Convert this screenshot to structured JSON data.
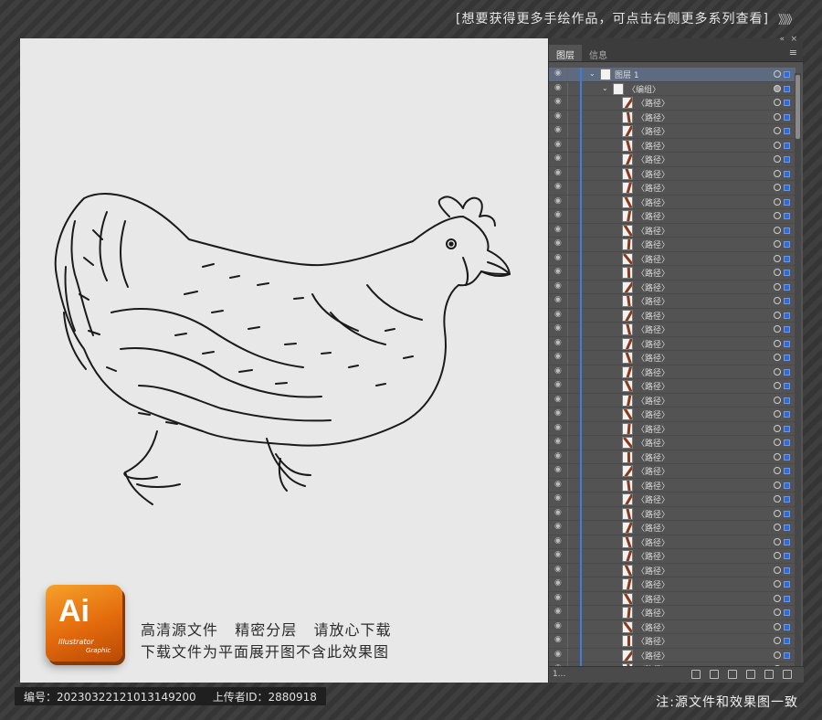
{
  "banner": {
    "text": "[想要获得更多手绘作品，可点击右侧更多系列查看]",
    "chevrons": "》》》"
  },
  "canvas": {
    "background": "#e8e8e8",
    "subject": "chicken-line-drawing"
  },
  "ai_logo": {
    "big": "Ai",
    "line1": "Illustrator",
    "line2": "Graphic"
  },
  "promo": {
    "line1": "高清源文件   精密分层   请放心下载",
    "line2": "下载文件为平面展开图不含此效果图"
  },
  "footer": {
    "id_label": "编号：20230322121013149200",
    "uploader_label": "上传者ID：2880918",
    "note": "注:源文件和效果图一致"
  },
  "panel": {
    "tabs": [
      "图层",
      "信息"
    ],
    "menu_icon": "≡",
    "layer_top": "图层 1",
    "group": "编组",
    "path_label": "路径",
    "path_row_count": 41,
    "footer_count": "1..."
  },
  "colors": {
    "accent": "#3f7ce0",
    "select": "#2e6ad8",
    "logo_orange": "#e36a0c"
  }
}
